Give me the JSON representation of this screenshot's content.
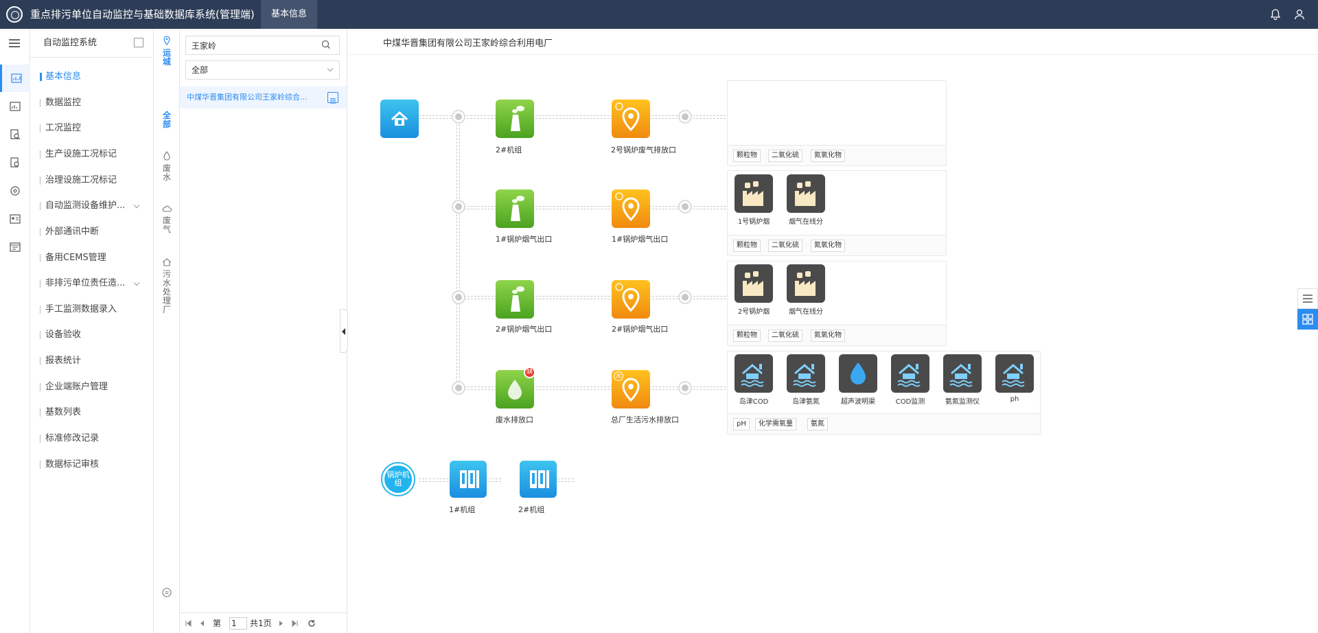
{
  "header": {
    "title": "重点排污单位自动监控与基础数据库系统(管理端)",
    "active_tab": "基本信息"
  },
  "nav": {
    "title": "自动监控系统",
    "items": [
      {
        "label": "基本信息",
        "active": true
      },
      {
        "label": "数据监控"
      },
      {
        "label": "工况监控"
      },
      {
        "label": "生产设施工况标记"
      },
      {
        "label": "治理设施工况标记"
      },
      {
        "label": "自动监测设备维护...",
        "expandable": true
      },
      {
        "label": "外部通讯中断"
      },
      {
        "label": "备用CEMS管理"
      },
      {
        "label": "非排污单位责任造...",
        "expandable": true
      },
      {
        "label": "手工监测数据录入"
      },
      {
        "label": "设备验收"
      },
      {
        "label": "报表统计"
      },
      {
        "label": "企业端账户管理"
      },
      {
        "label": "基数列表"
      },
      {
        "label": "标准修改记录"
      },
      {
        "label": "数据标记审核"
      }
    ]
  },
  "categories": [
    {
      "label": "运城",
      "icon": "location-icon"
    },
    {
      "label": "全部",
      "active": true
    },
    {
      "label": "废水",
      "icon": "water-drop-icon"
    },
    {
      "label": "废气",
      "icon": "cloud-icon"
    },
    {
      "label": "污水处理厂",
      "icon": "house-icon"
    }
  ],
  "list": {
    "search_value": "王家岭",
    "filter_value": "全部",
    "company": "中煤华晋集团有限公司王家岭综合...",
    "pager": {
      "page_prefix": "第",
      "page": "1",
      "total": "共1页"
    }
  },
  "main": {
    "title": "中煤华晋集团有限公司王家岭综合利用电厂",
    "rows": [
      {
        "source_label": "2#机组",
        "outlet_label": "2号锅炉废气排放口",
        "devices": [],
        "tags": [
          "颗粒物",
          "二氧化硫",
          "氮氧化物"
        ]
      },
      {
        "source_label": "1#锅炉烟气出口",
        "outlet_label": "1#锅炉烟气出口",
        "devices": [
          "1号锅炉烟",
          "烟气在线分"
        ],
        "tags": [
          "颗粒物",
          "二氧化硫",
          "氮氧化物"
        ]
      },
      {
        "source_label": "2#锅炉烟气出口",
        "outlet_label": "2#锅炉烟气出口",
        "devices": [
          "2号锅炉烟",
          "烟气在线分"
        ],
        "tags": [
          "颗粒物",
          "二氧化硫",
          "氮氧化物"
        ]
      },
      {
        "source_label": "废水排放口",
        "source_badge": "缺",
        "outlet_label": "总厂生活污水排放口",
        "outlet_badge": "水",
        "devices": [
          "岛津COD",
          "岛津氨氮",
          "超声波明渠",
          "COD监测",
          "氨氮监测仪",
          "ph"
        ],
        "tags": [
          "pH",
          "化学需氧量",
          "氨氮"
        ]
      }
    ],
    "boiler": {
      "label": "锅炉机组",
      "units": [
        "1#机组",
        "2#机组"
      ]
    }
  },
  "colors": {
    "header_bg": "#2e3d57",
    "accent": "#2c8cf0",
    "green": "#5ab62d",
    "orange": "#f5a014",
    "cyan": "#23b4ee"
  }
}
